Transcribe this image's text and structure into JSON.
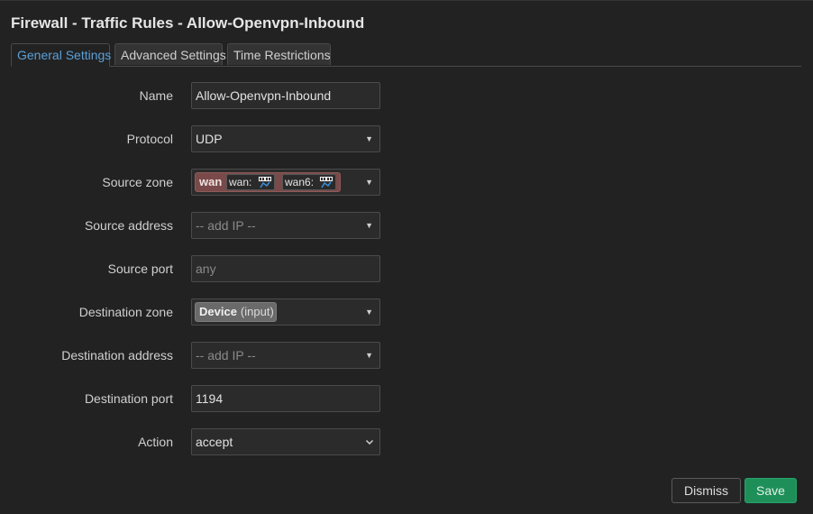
{
  "modal": {
    "title": "Firewall - Traffic Rules - Allow-Openvpn-Inbound"
  },
  "tabs": [
    {
      "label": "General Settings",
      "active": true
    },
    {
      "label": "Advanced Settings",
      "active": false
    },
    {
      "label": "Time Restrictions",
      "active": false
    }
  ],
  "form": {
    "name": {
      "label": "Name",
      "value": "Allow-Openvpn-Inbound"
    },
    "protocol": {
      "label": "Protocol",
      "value": "UDP"
    },
    "source_zone": {
      "label": "Source zone",
      "zone": "wan",
      "interfaces": [
        "wan:",
        "wan6:"
      ]
    },
    "source_address": {
      "label": "Source address",
      "placeholder": "-- add IP --"
    },
    "source_port": {
      "label": "Source port",
      "placeholder": "any"
    },
    "destination_zone": {
      "label": "Destination zone",
      "zone": "Device",
      "zone_detail": "(input)"
    },
    "destination_address": {
      "label": "Destination address",
      "placeholder": "-- add IP --"
    },
    "destination_port": {
      "label": "Destination port",
      "value": "1194"
    },
    "action": {
      "label": "Action",
      "value": "accept"
    }
  },
  "footer": {
    "dismiss_label": "Dismiss",
    "save_label": "Save"
  },
  "colors": {
    "background": "#222222",
    "active_tab_text": "#5aa0d8",
    "wan_zone": "#7a4a4a",
    "device_zone": "#6a6a6a",
    "save_button": "#1f8f5a"
  },
  "icons": {
    "interface": "network-port-icon",
    "select_caret": "caret-down-icon",
    "select_chevron": "chevron-down-icon"
  }
}
